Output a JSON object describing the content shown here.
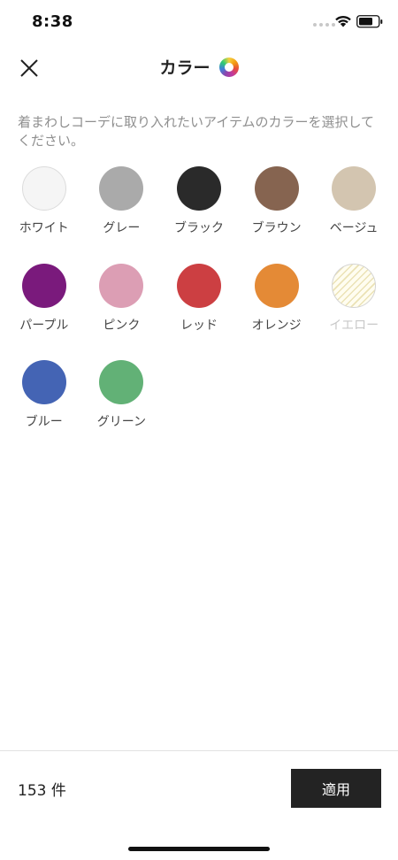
{
  "status_bar": {
    "time": "8:38"
  },
  "header": {
    "title": "カラー",
    "close_icon": "close-icon",
    "title_icon": "color-wheel-icon"
  },
  "description": "着まわしコーデに取り入れたいアイテムのカラーを選択してください。",
  "colors": [
    {
      "label": "ホワイト",
      "color": "#f5f5f5",
      "bordered": true,
      "pattern": "solid",
      "enabled": true
    },
    {
      "label": "グレー",
      "color": "#aaaaaa",
      "bordered": false,
      "pattern": "solid",
      "enabled": true
    },
    {
      "label": "ブラック",
      "color": "#2a2a2a",
      "bordered": false,
      "pattern": "solid",
      "enabled": true
    },
    {
      "label": "ブラウン",
      "color": "#866450",
      "bordered": false,
      "pattern": "solid",
      "enabled": true
    },
    {
      "label": "ベージュ",
      "color": "#d3c5b0",
      "bordered": false,
      "pattern": "solid",
      "enabled": true
    },
    {
      "label": "パープル",
      "color": "#7a1a7c",
      "bordered": false,
      "pattern": "solid",
      "enabled": true
    },
    {
      "label": "ピンク",
      "color": "#dc9eb4",
      "bordered": false,
      "pattern": "solid",
      "enabled": true
    },
    {
      "label": "レッド",
      "color": "#cc3f42",
      "bordered": false,
      "pattern": "solid",
      "enabled": true
    },
    {
      "label": "オレンジ",
      "color": "#e48a36",
      "bordered": false,
      "pattern": "solid",
      "enabled": true
    },
    {
      "label": "イエロー",
      "color": "#ebe2b5",
      "bordered": true,
      "pattern": "striped",
      "enabled": false
    },
    {
      "label": "ブルー",
      "color": "#4464b4",
      "bordered": false,
      "pattern": "solid",
      "enabled": true
    },
    {
      "label": "グリーン",
      "color": "#62b176",
      "bordered": false,
      "pattern": "solid",
      "enabled": true
    }
  ],
  "footer": {
    "count": "153 件",
    "apply_label": "適用"
  },
  "theme": {
    "apply_button_bg": "#232323",
    "muted_text": "#8f8f8f"
  }
}
